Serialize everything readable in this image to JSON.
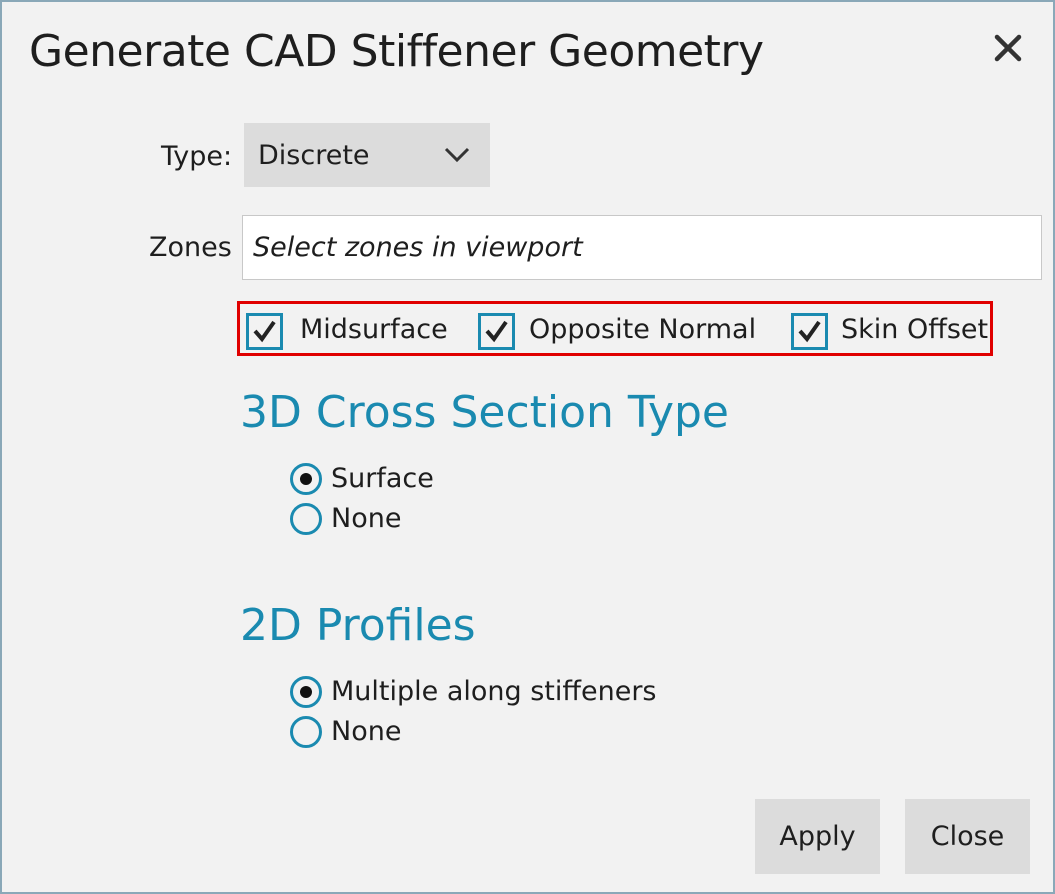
{
  "dialog": {
    "title": "Generate CAD Stiffener Geometry"
  },
  "icons": {
    "close": "close-icon",
    "dropdown": "chevron-down-icon",
    "check": "checkmark-icon"
  },
  "colors": {
    "accent": "#1a8ab0",
    "highlight_border": "#e00000",
    "background": "#f2f2f2",
    "control_bg": "#dcdcdc"
  },
  "type": {
    "label": "Type:",
    "selected": "Discrete"
  },
  "zones": {
    "label": "Zones",
    "placeholder": "Select zones in viewport"
  },
  "options": [
    {
      "label": "Midsurface",
      "checked": true
    },
    {
      "label": "Opposite Normal",
      "checked": true
    },
    {
      "label": "Skin Offset",
      "checked": true
    }
  ],
  "cross_section": {
    "heading": "3D Cross Section Type",
    "choices": [
      {
        "label": "Surface",
        "selected": true
      },
      {
        "label": "None",
        "selected": false
      }
    ]
  },
  "profiles": {
    "heading": "2D Profiles",
    "choices": [
      {
        "label": "Multiple along stiffeners",
        "selected": true
      },
      {
        "label": "None",
        "selected": false
      }
    ]
  },
  "buttons": {
    "apply": "Apply",
    "close": "Close"
  }
}
